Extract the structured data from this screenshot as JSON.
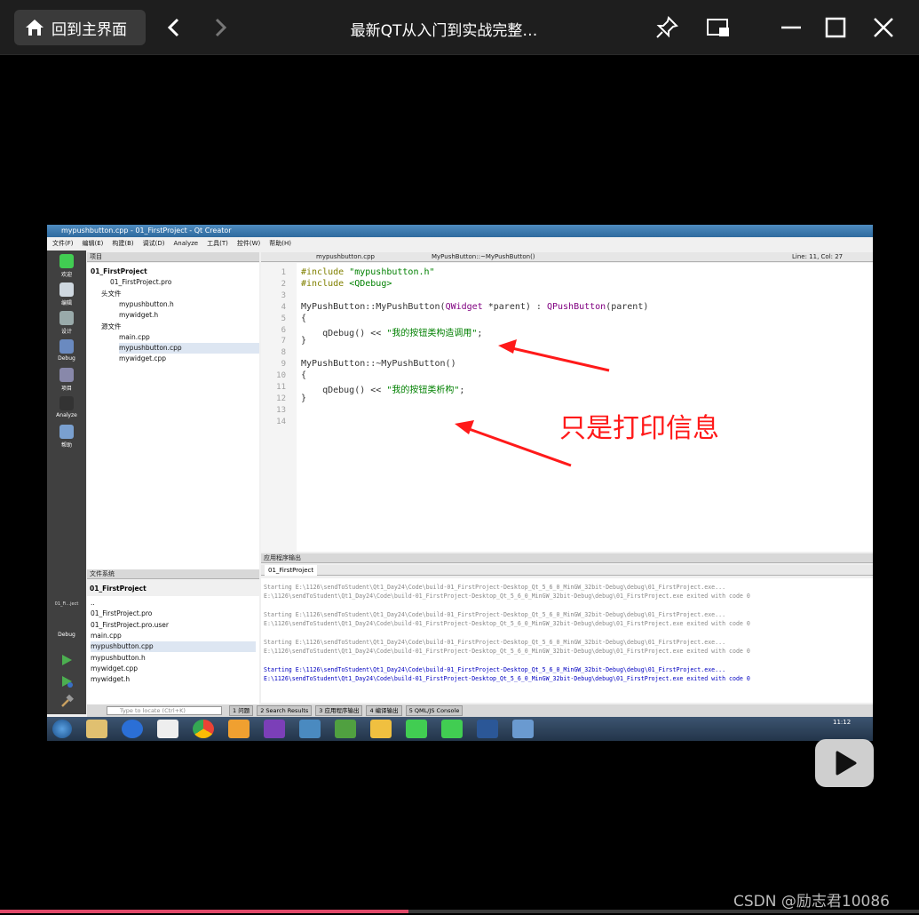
{
  "player": {
    "home_label": "回到主界面",
    "title": "最新QT从入门到实战完整…",
    "icons": [
      "home-icon",
      "back-icon",
      "forward-icon",
      "pin-icon",
      "pip-icon",
      "minimize-icon",
      "maximize-icon",
      "close-icon"
    ]
  },
  "qt": {
    "window_title": "mypushbutton.cpp - 01_FirstProject - Qt Creator",
    "menu": [
      "文件(F)",
      "编辑(E)",
      "构建(B)",
      "调试(D)",
      "Analyze",
      "工具(T)",
      "控件(W)",
      "帮助(H)"
    ],
    "modes": [
      "欢迎",
      "编辑",
      "设计",
      "Debug",
      "项目",
      "Analyze",
      "帮助"
    ],
    "project_panel_title": "项目",
    "tree": [
      {
        "label": "01_FirstProject",
        "bold": true
      },
      {
        "label": "01_FirstProject.pro"
      },
      {
        "label": "头文件"
      },
      {
        "label": "mypushbutton.h"
      },
      {
        "label": "mywidget.h"
      },
      {
        "label": "源文件"
      },
      {
        "label": "main.cpp"
      },
      {
        "label": "mypushbutton.cpp"
      },
      {
        "label": "mywidget.cpp"
      }
    ],
    "editor_tab": "mypushbutton.cpp",
    "editor_symbol": "MyPushButton::~MyPushButton()",
    "cursor_pos": "Line: 11, Col: 27",
    "code_lines": [
      "#include \"mypushbutton.h\"",
      "#include <QDebug>",
      "",
      "MyPushButton::MyPushButton(QWidget *parent) : QPushButton(parent)",
      "{",
      "    qDebug() << \"我的按钮类构造调用\";",
      "}",
      "",
      "MyPushButton::~MyPushButton()",
      "{",
      "    qDebug() << \"我的按钮类析构\";",
      "}",
      "",
      ""
    ],
    "fs_panel_title": "文件系统",
    "fs_root": "01_FirstProject",
    "fs_items": [
      "..",
      "01_FirstProject.pro",
      "01_FirstProject.pro.user",
      "main.cpp",
      "mypushbutton.cpp",
      "mypushbutton.h",
      "mywidget.cpp",
      "mywidget.h"
    ],
    "run_target": "01_Fi...ject",
    "run_mode": "Debug",
    "output_title": "应用程序输出",
    "output_tab": "01_FirstProject",
    "output_lines": [
      {
        "text": "Starting E:\\1126\\sendToStudent\\Qt1_Day24\\Code\\build-01_FirstProject-Desktop_Qt_5_6_0_MinGW_32bit-Debug\\debug\\01_FirstProject.exe...",
        "blue": false
      },
      {
        "text": "E:\\1126\\sendToStudent\\Qt1_Day24\\Code\\build-01_FirstProject-Desktop_Qt_5_6_0_MinGW_32bit-Debug\\debug\\01_FirstProject.exe exited with code 0",
        "blue": false
      },
      {
        "text": "",
        "blue": false
      },
      {
        "text": "Starting E:\\1126\\sendToStudent\\Qt1_Day24\\Code\\build-01_FirstProject-Desktop_Qt_5_6_0_MinGW_32bit-Debug\\debug\\01_FirstProject.exe...",
        "blue": false
      },
      {
        "text": "E:\\1126\\sendToStudent\\Qt1_Day24\\Code\\build-01_FirstProject-Desktop_Qt_5_6_0_MinGW_32bit-Debug\\debug\\01_FirstProject.exe exited with code 0",
        "blue": false
      },
      {
        "text": "",
        "blue": false
      },
      {
        "text": "Starting E:\\1126\\sendToStudent\\Qt1_Day24\\Code\\build-01_FirstProject-Desktop_Qt_5_6_0_MinGW_32bit-Debug\\debug\\01_FirstProject.exe...",
        "blue": false
      },
      {
        "text": "E:\\1126\\sendToStudent\\Qt1_Day24\\Code\\build-01_FirstProject-Desktop_Qt_5_6_0_MinGW_32bit-Debug\\debug\\01_FirstProject.exe exited with code 0",
        "blue": false
      },
      {
        "text": "",
        "blue": false
      },
      {
        "text": "Starting E:\\1126\\sendToStudent\\Qt1_Day24\\Code\\build-01_FirstProject-Desktop_Qt_5_6_0_MinGW_32bit-Debug\\debug\\01_FirstProject.exe...",
        "blue": true
      },
      {
        "text": "E:\\1126\\sendToStudent\\Qt1_Day24\\Code\\build-01_FirstProject-Desktop_Qt_5_6_0_MinGW_32bit-Debug\\debug\\01_FirstProject.exe exited with code 0",
        "blue": true
      }
    ],
    "locate_placeholder": "Type to locate (Ctrl+K)",
    "bottom_tabs": [
      "1 问题",
      "2 Search Results",
      "3 应用程序输出",
      "4 编译输出",
      "5 QML/JS Console"
    ],
    "clock": "11:12"
  },
  "annotation": "只是打印信息",
  "watermark": "CSDN @励志君10086"
}
